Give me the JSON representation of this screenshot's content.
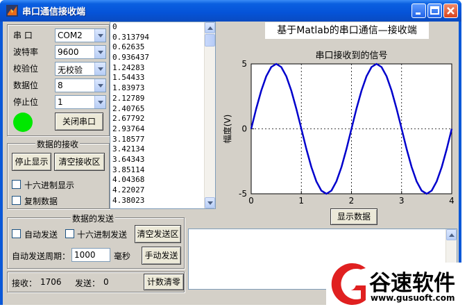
{
  "window": {
    "title": "串口通信接收端",
    "controls": [
      "minimize-icon",
      "maximize-icon",
      "close-icon"
    ]
  },
  "serial_settings": {
    "port_label": "串  口",
    "port_value": "COM2",
    "baud_label": "波特率",
    "baud_value": "9600",
    "parity_label": "校验位",
    "parity_value": "无校验",
    "databits_label": "数据位",
    "databits_value": "8",
    "stopbits_label": "停止位",
    "stopbits_value": "1",
    "status_color": "#00e800",
    "close_port_button": "关闭串口"
  },
  "receive_panel": {
    "title": "数据的接收",
    "stop_display_button": "停止显示",
    "clear_receive_button": "清空接收区",
    "hex_display_label": "十六进制显示",
    "copy_data_label": "复制数据"
  },
  "received_list": [
    "0",
    "0.313794",
    "0.62635",
    "0.936437",
    "1.24283",
    "1.54433",
    "1.83973",
    "2.12789",
    "2.40765",
    "2.67792",
    "2.93764",
    "3.18577",
    "3.42134",
    "3.64343",
    "3.85114",
    "4.04368",
    "4.22027",
    "4.38023"
  ],
  "send_panel": {
    "title": "数据的发送",
    "auto_send_label": "自动发送",
    "hex_send_label": "十六进制发送",
    "clear_send_button": "清空发送区",
    "period_label": "自动发送周期：",
    "period_value": "1000",
    "period_unit": "毫秒",
    "manual_send_button": "手动发送"
  },
  "status_bar": {
    "receive_label": "接收：",
    "receive_count": "1706",
    "send_label": "发送：",
    "send_count": "0",
    "reset_count_button": "计数清零"
  },
  "header": {
    "app_heading": "基于Matlab的串口通信—接收端"
  },
  "show_data_button": "显示数据",
  "chart_data": {
    "type": "line",
    "title": "串口接收到的信号",
    "xlabel": "",
    "ylabel": "幅度(V)",
    "xlim": [
      0,
      4
    ],
    "ylim": [
      -5,
      5
    ],
    "xticks": [
      "0",
      "1",
      "2",
      "3",
      "4"
    ],
    "yticks": [
      "5",
      "0",
      "-5"
    ],
    "grid": true,
    "line_color": "#0000cc",
    "series": [
      {
        "x": [
          0,
          0.1,
          0.2,
          0.3,
          0.4,
          0.5,
          0.6,
          0.7,
          0.8,
          0.9,
          1.0,
          1.1,
          1.2,
          1.3,
          1.4,
          1.5,
          1.6,
          1.7,
          1.8,
          1.9,
          2.0,
          2.1,
          2.2,
          2.3,
          2.4,
          2.5,
          2.6,
          2.7,
          2.8,
          2.9,
          3.0,
          3.1,
          3.2,
          3.3,
          3.4,
          3.5,
          3.6,
          3.7,
          3.8,
          3.9,
          4.0
        ],
        "y": [
          0,
          1.55,
          2.94,
          4.05,
          4.76,
          5.0,
          4.76,
          4.05,
          2.94,
          1.55,
          0,
          -1.55,
          -2.94,
          -4.05,
          -4.76,
          -5.0,
          -4.76,
          -4.05,
          -2.94,
          -1.55,
          0,
          1.55,
          2.94,
          4.05,
          4.76,
          5.0,
          4.76,
          4.05,
          2.94,
          1.55,
          0,
          -1.55,
          -2.94,
          -4.05,
          -4.76,
          -5.0,
          -4.76,
          -4.05,
          -2.94,
          -1.55,
          0
        ]
      }
    ]
  },
  "watermark": {
    "brand_text": "谷速软件",
    "url_text": "www.gusuoft.com"
  }
}
